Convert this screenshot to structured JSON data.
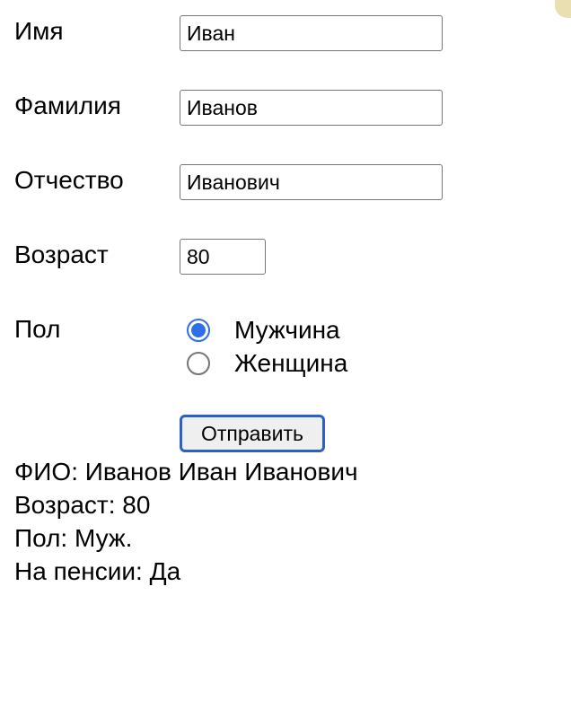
{
  "form": {
    "first_name": {
      "label": "Имя",
      "value": "Иван"
    },
    "last_name": {
      "label": "Фамилия",
      "value": "Иванов"
    },
    "patronymic": {
      "label": "Отчество",
      "value": "Иванович"
    },
    "age": {
      "label": "Возраст",
      "value": "80"
    },
    "gender": {
      "label": "Пол",
      "options": [
        {
          "label": "Мужчина",
          "selected": true
        },
        {
          "label": "Женщина",
          "selected": false
        }
      ]
    },
    "submit_label": "Отправить"
  },
  "result": {
    "fio": "ФИО: Иванов Иван Иванович",
    "age": "Возраст: 80",
    "gender": "Пол: Муж.",
    "pension": "На пенсии: Да"
  },
  "colors": {
    "accent": "#2f6fe4",
    "button_border": "#2d5fc4",
    "window_tab": "#e9dfb0"
  }
}
